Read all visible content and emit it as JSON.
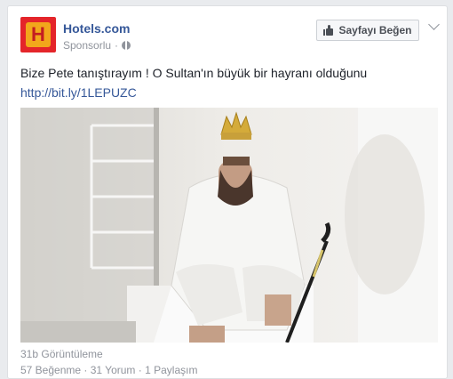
{
  "post": {
    "page_name": "Hotels.com",
    "sponsored_label": "Sponsorlu",
    "separator": "·",
    "logo_letter": "H",
    "like_button_label": "Sayfayı Beğen",
    "text": "Bize Pete tanıştırayım ! O Sultan'ın büyük bir hayranı olduğunu",
    "link": "http://bit.ly/1LEPUZC",
    "views": "31b Görüntüleme",
    "reactions_partial": "57 Beğenme · 31 Yorum · 1 Paylaşım"
  },
  "colors": {
    "brand_red": "#e4252a",
    "brand_yellow": "#f2a71b",
    "link_blue": "#365899"
  },
  "icons": {
    "logo": "hotels-logo-icon",
    "privacy": "globe-icon",
    "like": "thumbs-up-icon",
    "menu": "chevron-down-icon"
  }
}
